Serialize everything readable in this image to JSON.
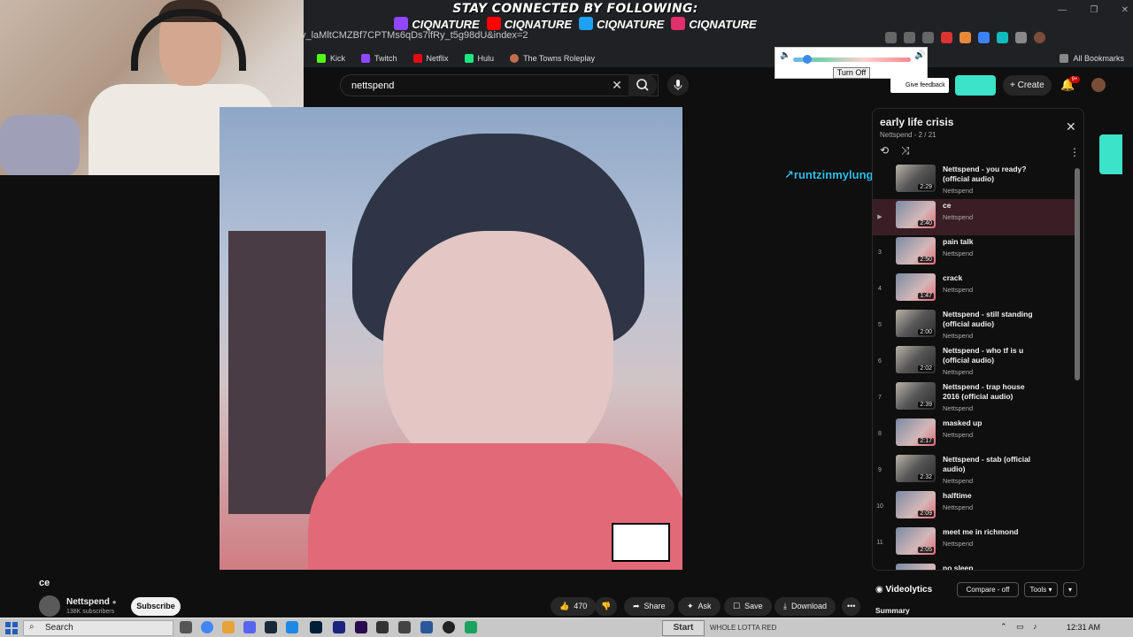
{
  "banner": {
    "headline": "STAY CONNECTED BY FOLLOWING:",
    "socials": [
      {
        "icon": "twitch-icon",
        "handle": "CIQNATURE",
        "color": "#9146ff"
      },
      {
        "icon": "youtube-icon",
        "handle": "CIQNATURE",
        "color": "#ff0000"
      },
      {
        "icon": "twitter-icon",
        "handle": "CIQNATURE",
        "color": "#1da1f2"
      },
      {
        "icon": "instagram-icon",
        "handle": "CIQNATURE",
        "color": "#e1306c"
      }
    ]
  },
  "browser": {
    "url": "y_laMltCMZBf7CPTMs6qDs7lfRy_t5g98dU&index=2",
    "bookmarks": [
      {
        "label": "Kick",
        "color": "#53fc18"
      },
      {
        "label": "Twitch",
        "color": "#9146ff"
      },
      {
        "label": "Netflix",
        "color": "#e50914"
      },
      {
        "label": "Hulu",
        "color": "#1ce783"
      },
      {
        "label": "The Towns Roleplay",
        "color": "#c46f4a"
      }
    ],
    "all_bookmarks": "All Bookmarks"
  },
  "volume_popup": {
    "level": 0.12,
    "turn_off_label": "Turn Off"
  },
  "youtube_header": {
    "search_value": "nettspend",
    "feedback_label": "Give feedback",
    "create_label": "Create",
    "notification_count": "9+"
  },
  "video": {
    "title": "ce",
    "channel": "Nettspend",
    "subscribers": "138K subscribers",
    "subscribe_label": "Subscribe",
    "likes": "470",
    "share_label": "Share",
    "ask_label": "Ask",
    "save_label": "Save",
    "download_label": "Download"
  },
  "overlay_name": "runtzinmylungs:",
  "playlist": {
    "title": "early life crisis",
    "subtitle": "Nettspend - 2 / 21",
    "items": [
      {
        "index": "",
        "title": "Nettspend - you ready? (official audio)",
        "channel": "Nettspend",
        "duration": "2:29",
        "thumb": "gray",
        "active": false
      },
      {
        "index": "▶",
        "title": "ce",
        "channel": "Nettspend",
        "duration": "2:40",
        "thumb": "color",
        "active": true
      },
      {
        "index": "3",
        "title": "pain talk",
        "channel": "Nettspend",
        "duration": "2:50",
        "thumb": "color",
        "active": false
      },
      {
        "index": "4",
        "title": "crack",
        "channel": "Nettspend",
        "duration": "1:47",
        "thumb": "color",
        "active": false
      },
      {
        "index": "5",
        "title": "Nettspend - still standing (official audio)",
        "channel": "Nettspend",
        "duration": "2:00",
        "thumb": "gray",
        "active": false
      },
      {
        "index": "6",
        "title": "Nettspend - who tf is u (official audio)",
        "channel": "Nettspend",
        "duration": "2:02",
        "thumb": "gray",
        "active": false
      },
      {
        "index": "7",
        "title": "Nettspend - trap house 2016 (official audio)",
        "channel": "Nettspend",
        "duration": "2:39",
        "thumb": "gray",
        "active": false
      },
      {
        "index": "8",
        "title": "masked up",
        "channel": "Nettspend",
        "duration": "2:17",
        "thumb": "color",
        "active": false
      },
      {
        "index": "9",
        "title": "Nettspend - stab (official audio)",
        "channel": "Nettspend",
        "duration": "2:32",
        "thumb": "gray",
        "active": false
      },
      {
        "index": "10",
        "title": "halftime",
        "channel": "Nettspend",
        "duration": "2:09",
        "thumb": "color",
        "active": false
      },
      {
        "index": "11",
        "title": "meet me in richmond",
        "channel": "Nettspend",
        "duration": "2:05",
        "thumb": "color",
        "active": false
      },
      {
        "index": "12",
        "title": "no sleep",
        "channel": "Nettspend",
        "duration": "",
        "thumb": "color",
        "active": false
      }
    ]
  },
  "videolytics": {
    "logo_label": "Videolytics",
    "compare_label": "Compare - off",
    "tools_label": "Tools",
    "summary_label": "Summary"
  },
  "taskbar": {
    "search_label": "Search",
    "start_label": "Start",
    "media_label": "WHOLE LOTTA RED",
    "time": "12:31 AM"
  }
}
